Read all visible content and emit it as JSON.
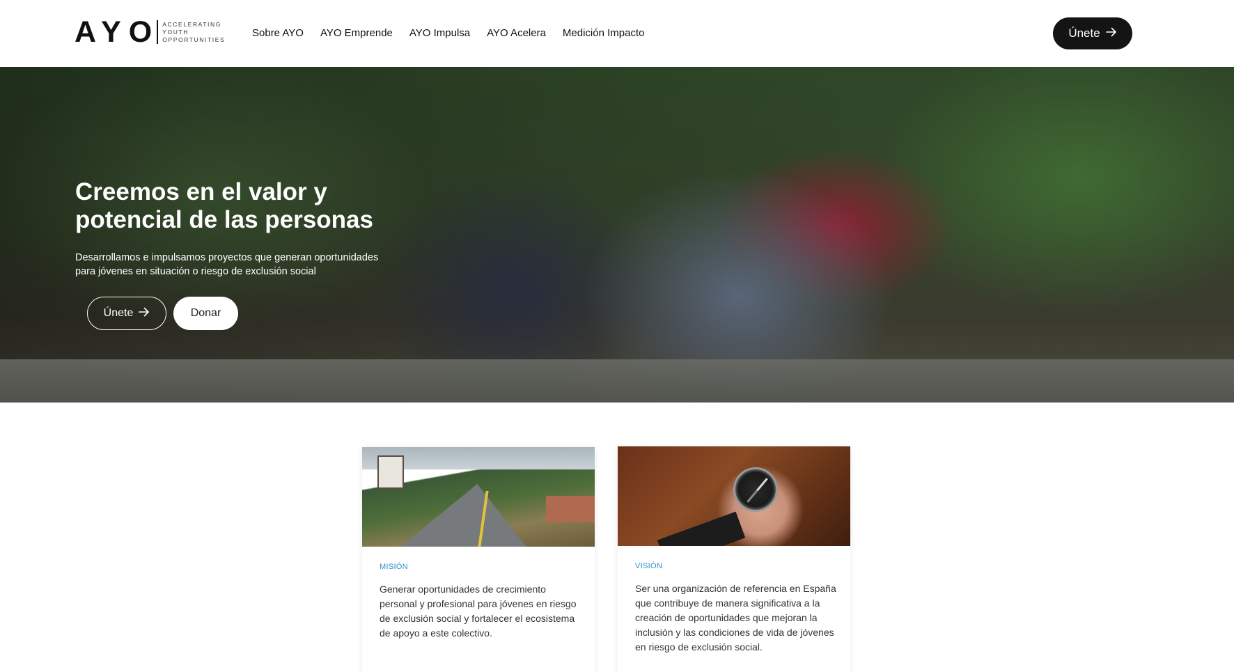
{
  "header": {
    "logo_word": "AYO",
    "logo_tagline": [
      "ACCELERATING",
      "YOUTH",
      "OPPORTUNITIES"
    ],
    "nav": [
      "Sobre AYO",
      "AYO Emprende",
      "AYO Impulsa",
      "AYO Acelera",
      "Medición Impacto"
    ],
    "join_label": "Únete"
  },
  "hero": {
    "title_line1": "Creemos en el valor y",
    "title_line2": "potencial de las personas",
    "subtitle_line1": "Desarrollamos e impulsamos proyectos que generan oportunidades",
    "subtitle_line2": "para jóvenes en situación o riesgo de exclusión social",
    "join_label": "Únete",
    "donate_label": "Donar"
  },
  "cards": [
    {
      "label": "MISIÓN",
      "text": "Generar oportunidades de crecimiento personal y profesional para jóvenes en riesgo de exclusión social y fortalecer el ecosistema de apoyo a este colectivo."
    },
    {
      "label": "VISIÓN",
      "text": "Ser una organización de referencia en España que contribuye de manera significativa a la creación de oportunidades que mejoran la inclusión y las condiciones de vida de jóvenes en riesgo de exclusión social."
    }
  ],
  "colors": {
    "accent_label": "#2a8fc9",
    "dark_button": "#141414"
  },
  "icons": {
    "arrow": "arrow-right-icon"
  }
}
